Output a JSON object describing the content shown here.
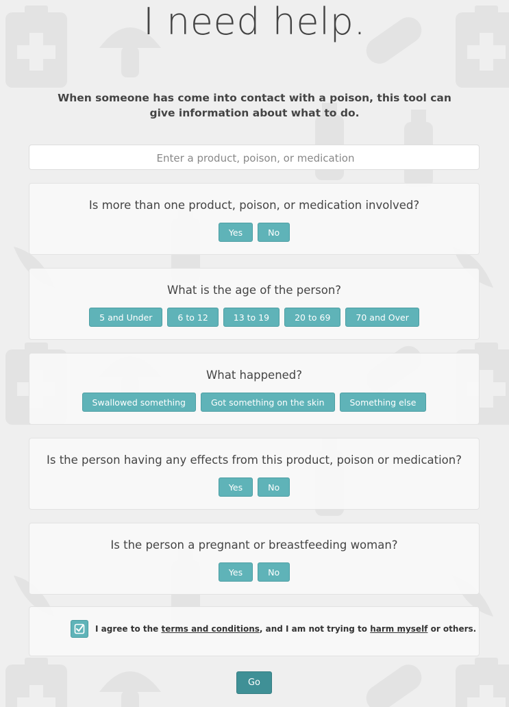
{
  "page": {
    "title": "I need help.",
    "intro": "When someone has come into contact with a poison, this tool can give information about what to do."
  },
  "search": {
    "placeholder": "Enter a product, poison, or medication",
    "value": ""
  },
  "questions": [
    {
      "text": "Is more than one product, poison, or medication involved?",
      "options": [
        "Yes",
        "No"
      ]
    },
    {
      "text": "What is the age of the person?",
      "options": [
        "5 and Under",
        "6 to 12",
        "13 to 19",
        "20 to 69",
        "70 and Over"
      ]
    },
    {
      "text": "What happened?",
      "options": [
        "Swallowed something",
        "Got something on the skin",
        "Something else"
      ]
    },
    {
      "text": "Is the person having any effects from this product, poison or medication?",
      "options": [
        "Yes",
        "No"
      ]
    },
    {
      "text": "Is the person a pregnant or breastfeeding woman?",
      "options": [
        "Yes",
        "No"
      ]
    }
  ],
  "agreement": {
    "checked": true,
    "prefix": "I agree to the ",
    "terms_link": "terms and conditions",
    "middle": ", and I am not trying to ",
    "harm_link": "harm myself",
    "suffix": " or others."
  },
  "submit": {
    "label": "Go"
  },
  "colors": {
    "background": "#efefef",
    "button": "#5fb3b8",
    "button_dark": "#3f9096",
    "text": "#444444"
  },
  "icons": [
    "first-aid-kit-icon",
    "mushroom-icon",
    "pill-icon",
    "snake-icon",
    "scorpion-icon",
    "bottle-icon",
    "plant-icon",
    "spider-icon",
    "checkmark-icon"
  ]
}
